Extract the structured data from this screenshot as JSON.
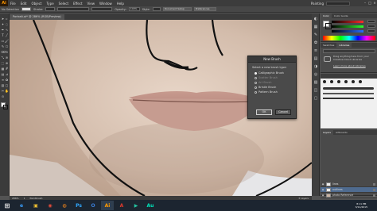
{
  "app": {
    "logo": "Ai",
    "workspace": "Painting"
  },
  "menu": [
    "File",
    "Edit",
    "Object",
    "Type",
    "Select",
    "Effect",
    "View",
    "Window",
    "Help"
  ],
  "control": {
    "selection": "No Selection",
    "stroke_label": "Stroke:",
    "opacity_label": "Opacity:",
    "opacity_value": "100%",
    "style_label": "Style:",
    "doc_setup": "Document Setup",
    "preferences": "Preferences"
  },
  "document": {
    "tab_title": "Portrait.ai* @ 286% (RGB/Preview)"
  },
  "dialog": {
    "title": "New Brush",
    "prompt": "Select a new brush type:",
    "options": [
      {
        "label": "Calligraphic Brush",
        "selected": true,
        "enabled": true
      },
      {
        "label": "Scatter Brush",
        "selected": false,
        "enabled": false
      },
      {
        "label": "Art Brush",
        "selected": false,
        "enabled": false
      },
      {
        "label": "Bristle Brush",
        "selected": false,
        "enabled": true
      },
      {
        "label": "Pattern Brush",
        "selected": false,
        "enabled": true
      }
    ],
    "ok": "OK",
    "cancel": "Cancel"
  },
  "panels": {
    "color_tabs": [
      "Color",
      "Color Guide"
    ],
    "swatch_tabs": [
      "Swatches",
      "Libraries"
    ],
    "library_text": "Drag anything here from your Creative Cloud Libraries",
    "library_link": "Learn more about Libraries",
    "layer_tabs": [
      "Layers",
      "Artboards"
    ],
    "layers": [
      {
        "name": "lines",
        "thumb": "#f2f2f2"
      },
      {
        "name": "outlines",
        "thumb": "#f2f2f2"
      },
      {
        "name": "photo Reference",
        "thumb": "#c9b3a2"
      }
    ],
    "layers_count": "3 Layers"
  },
  "status": {
    "zoom": "286%",
    "page": "1",
    "tool": "Paintbrush"
  },
  "taskbar": {
    "icons": [
      {
        "name": "ie",
        "glyph": "e",
        "color": "#3aa0ff"
      },
      {
        "name": "explorer",
        "glyph": "▣",
        "color": "#f1c232"
      },
      {
        "name": "chrome",
        "glyph": "◉",
        "color": "#e24b3a"
      },
      {
        "name": "firefox",
        "glyph": "◍",
        "color": "#ff8c1a"
      },
      {
        "name": "ps",
        "glyph": "Ps",
        "color": "#31a8ff"
      },
      {
        "name": "outlook",
        "glyph": "O",
        "color": "#3b7ed8"
      },
      {
        "name": "illustrator",
        "glyph": "Ai",
        "color": "#ff9a00"
      },
      {
        "name": "acrobat",
        "glyph": "A",
        "color": "#e03a2c"
      },
      {
        "name": "media",
        "glyph": "▶",
        "color": "#25c2a0"
      },
      {
        "name": "audition",
        "glyph": "Au",
        "color": "#00e4bb"
      }
    ],
    "time": "8:11 PM",
    "date": "3/11/2015"
  },
  "colors": {
    "accent": "#ff9a00",
    "dialog_bg": "#4a4a4a",
    "skin": "#d6c3b4"
  }
}
